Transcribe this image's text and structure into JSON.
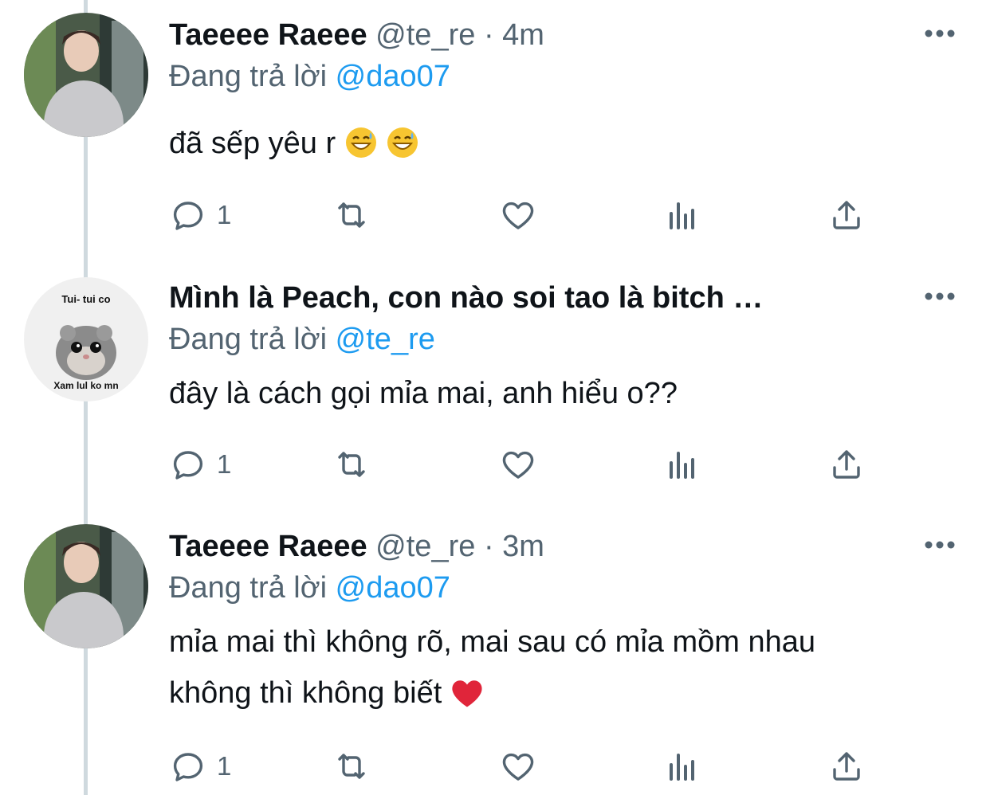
{
  "tweets": [
    {
      "display_name": "Taeeee Raeee",
      "handle": "@te_re",
      "separator": "·",
      "time": "4m",
      "reply_prefix": "Đang trả lời",
      "reply_to": "@dao07",
      "text_lines": [
        "đã sếp yêu r"
      ],
      "emojis": [
        "😅",
        "😅"
      ],
      "reply_count": "1",
      "avatar": "boy-photo"
    },
    {
      "display_name": "Mình là Peach, con nào soi tao là bitch …",
      "reply_prefix": "Đang trả lời",
      "reply_to": "@te_re",
      "text_lines": [
        "đây là cách gọi mỉa mai, anh hiểu o??"
      ],
      "reply_count": "1",
      "avatar": "hamster-meme",
      "avatar_text_top": "Tui- tui co",
      "avatar_text_bottom": "Xam lul ko mn"
    },
    {
      "display_name": "Taeeee Raeee",
      "handle": "@te_re",
      "separator": "·",
      "time": "3m",
      "reply_prefix": "Đang trả lời",
      "reply_to": "@dao07",
      "text_lines": [
        "mỉa mai thì không rõ, mai sau có mỉa mồm nhau",
        "không thì không biết"
      ],
      "emojis": [
        "❤️"
      ],
      "reply_count": "1",
      "avatar": "boy-photo"
    }
  ],
  "icons": {
    "more": "more-horizontal-icon",
    "reply": "reply-icon",
    "retweet": "retweet-icon",
    "like": "heart-icon",
    "views": "analytics-icon",
    "share": "share-icon"
  },
  "colors": {
    "text": "#0f1419",
    "secondary": "#536471",
    "link": "#1d9bf0",
    "thread_line": "#cfd9de"
  }
}
